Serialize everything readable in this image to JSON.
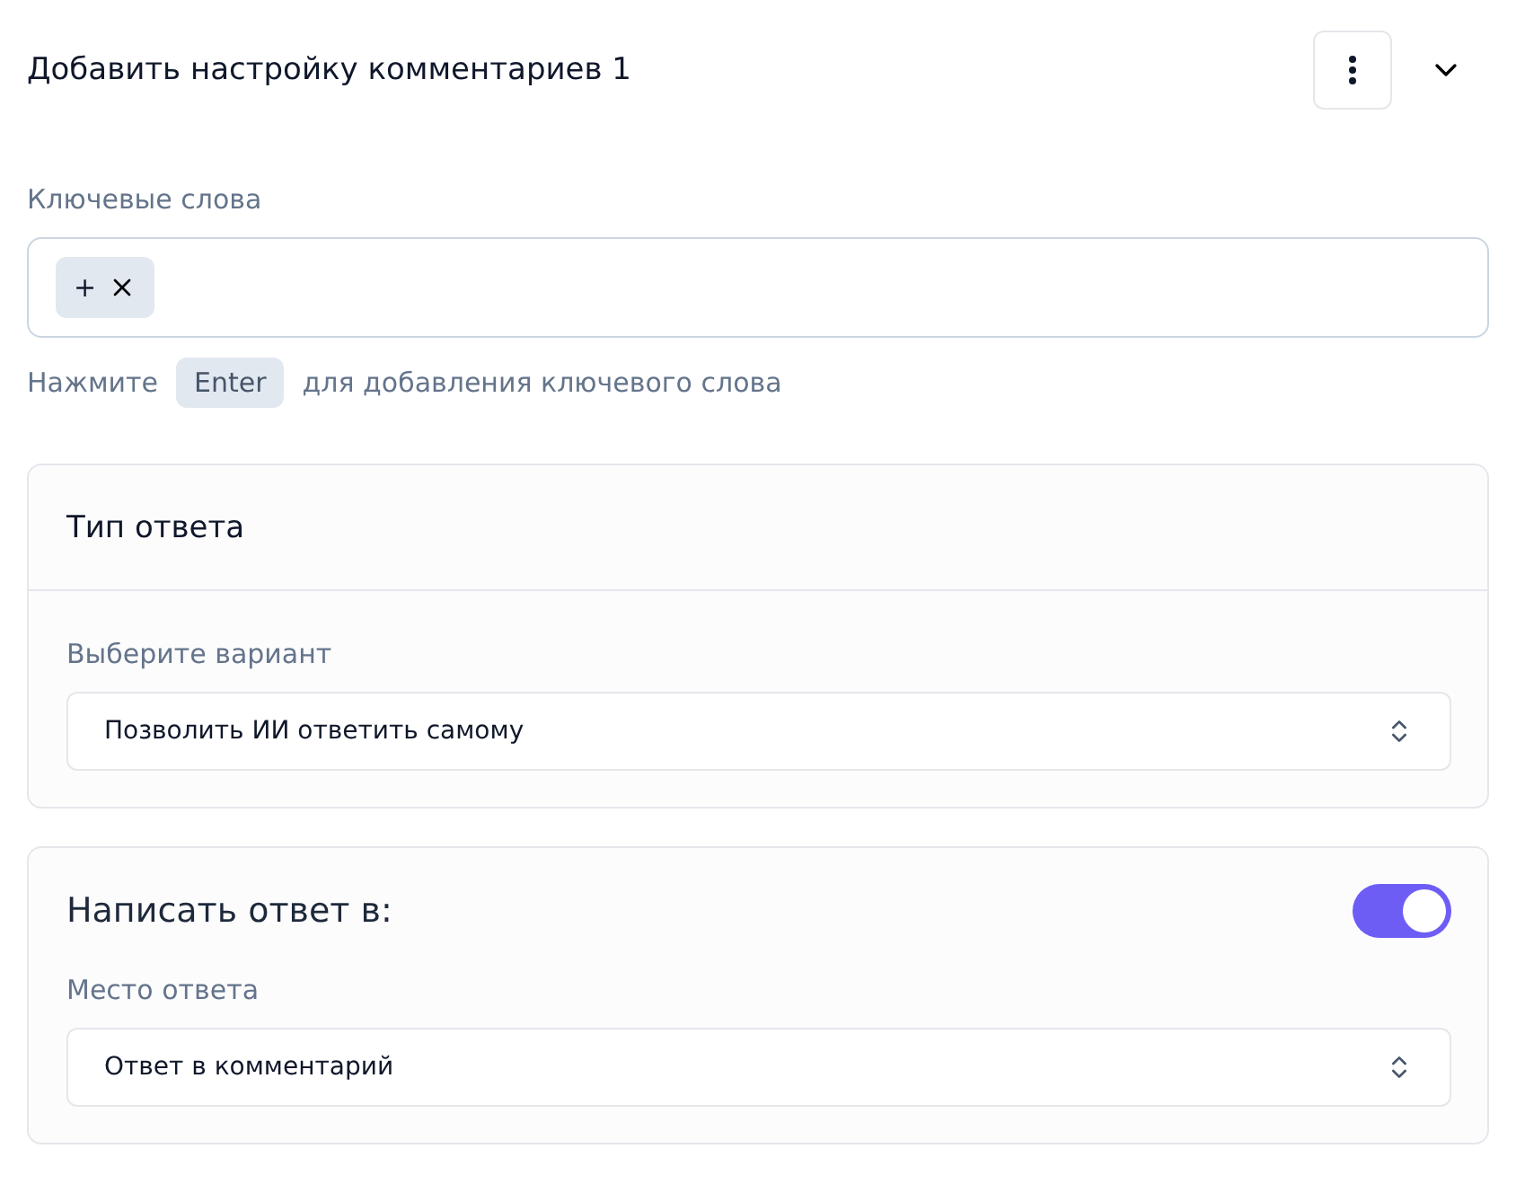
{
  "header": {
    "title": "Добавить настройку комментариев 1"
  },
  "keywords": {
    "label": "Ключевые слова",
    "tags": [
      {
        "label": "+"
      }
    ],
    "hint_before": "Нажмите",
    "hint_key": "Enter",
    "hint_after": "для добавления ключевого слова"
  },
  "response_type": {
    "title": "Тип ответа",
    "field_label": "Выберите вариант",
    "value": "Позволить ИИ ответить самому"
  },
  "reply_to": {
    "title": "Написать ответ в:",
    "on": true,
    "field_label": "Место ответа",
    "value": "Ответ в комментарий"
  }
}
